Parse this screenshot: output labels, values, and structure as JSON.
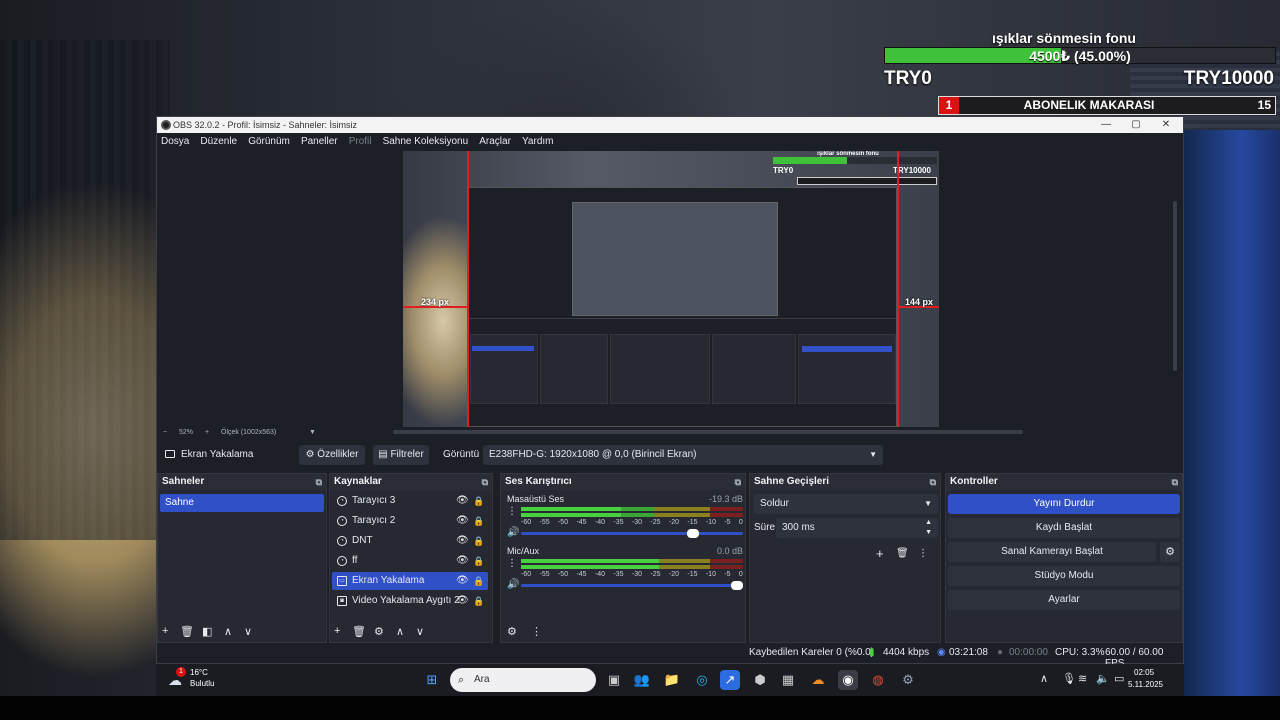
{
  "overlay": {
    "title": "ışıklar sönmesin fonu",
    "bar_text": "4500₺ (45.00%)",
    "progress_fraction": 0.45,
    "min": "TRY0",
    "max": "TRY10000",
    "sub_rank": "1",
    "sub_label": "ABONELIK MAKARASI",
    "sub_count": "15"
  },
  "obs": {
    "title": "OBS 32.0.2 - Profil: İsimsiz - Sahneler: İsimsiz",
    "window_buttons": {
      "minimize": "—",
      "maximize": "▢",
      "close": "✕"
    },
    "menu": [
      "Dosya",
      "Düzenle",
      "Görünüm",
      "Paneller",
      "Profil",
      "Sahne Koleksiyonu",
      "Araçlar",
      "Yardım"
    ],
    "preview": {
      "left_px_label": "234 px",
      "right_px_label": "144 px",
      "mini_title": "ışıklar sönmesin fonu",
      "mini_min": "TRY0",
      "mini_max": "TRY10000"
    },
    "zoom": {
      "minus": "−",
      "level": "52%",
      "plus": "+",
      "scale": "Ölçek (1002x563)",
      "caret": "▼"
    },
    "source_toolbar": {
      "source_name": "Ekran Yakalama",
      "properties": "⚙ Özellikler",
      "filters": "▤ Filtreler",
      "display_label": "Görüntü",
      "display_value": "E238FHD-G: 1920x1080 @ 0,0 (Birincil Ekran)",
      "caret": "▼"
    },
    "scenes": {
      "title": "Sahneler",
      "items": [
        "Sahne"
      ]
    },
    "sources": {
      "title": "Kaynaklar",
      "items": [
        {
          "name": "Tarayıcı 3",
          "icon": "browser-icon",
          "selected": false
        },
        {
          "name": "Tarayıcı 2",
          "icon": "browser-icon",
          "selected": false
        },
        {
          "name": "DNT",
          "icon": "browser-icon",
          "selected": false
        },
        {
          "name": "ff",
          "icon": "browser-icon",
          "selected": false
        },
        {
          "name": "Ekran Yakalama",
          "icon": "monitor-icon",
          "selected": true
        },
        {
          "name": "Video Yakalama Aygıtı 2",
          "icon": "camera-icon",
          "selected": false
        }
      ]
    },
    "mixer": {
      "title": "Ses Karıştırıcı",
      "channels": [
        {
          "name": "Masaüstü Ses",
          "db": "-19.3 dB",
          "level": 0.45,
          "volume": 0.8
        },
        {
          "name": "Mic/Aux",
          "db": "0.0 dB",
          "level": 0.62,
          "volume": 1.0
        }
      ],
      "scale": [
        "-60",
        "-55",
        "-50",
        "-45",
        "-40",
        "-35",
        "-30",
        "-25",
        "-20",
        "-15",
        "-10",
        "-5",
        "0"
      ]
    },
    "transitions": {
      "title": "Sahne Geçişleri",
      "type": "Soldur",
      "duration_label": "Süre",
      "duration_value": "300 ms"
    },
    "controls": {
      "title": "Kontroller",
      "stop_stream": "Yayını Durdur",
      "start_record": "Kaydı Başlat",
      "virtual_cam": "Sanal Kamerayı Başlat",
      "studio_mode": "Stüdyo Modu",
      "settings": "Ayarlar"
    },
    "status": {
      "dropped": "Kaybedilen Kareler 0 (%0.0)",
      "bitrate": "4404 kbps",
      "stream_time": "03:21:08",
      "record_time": "00:00:00",
      "cpu": "CPU: 3.3%",
      "fps": "60.00 / 60.00 FPS"
    }
  },
  "taskbar": {
    "temp": "16°C",
    "weather": "Bulutlu",
    "weather_badge": "1",
    "search_placeholder": "Ara",
    "time": "02:05",
    "date": "5.11.2025"
  },
  "colors": {
    "accent": "#3050c8",
    "progress": "#3fc23a",
    "badge": "#dd1111"
  }
}
